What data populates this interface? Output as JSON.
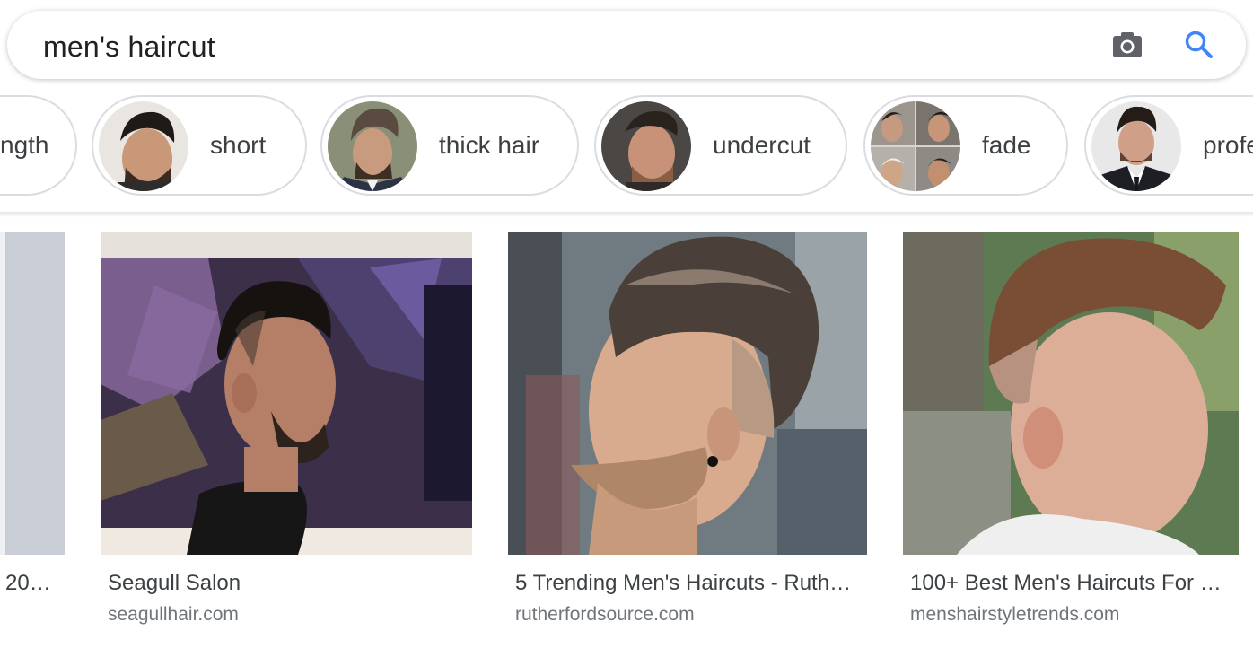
{
  "search": {
    "query": "men's haircut"
  },
  "icons": {
    "camera": "camera-icon",
    "search": "search-icon"
  },
  "chips": [
    {
      "label": "ngth",
      "partial": true
    },
    {
      "label": "short"
    },
    {
      "label": "thick hair"
    },
    {
      "label": "undercut"
    },
    {
      "label": "fade"
    },
    {
      "label": "profe",
      "partial": true
    }
  ],
  "results": [
    {
      "title": "20…",
      "site": ""
    },
    {
      "title": "Seagull Salon",
      "site": "seagullhair.com"
    },
    {
      "title": "5 Trending Men's Haircuts - Ruth…",
      "site": "rutherfordsource.com"
    },
    {
      "title": "100+ Best Men's Haircuts For …",
      "site": "menshairstyletrends.com"
    }
  ],
  "colors": {
    "search_blue": "#4285f4",
    "icon_gray": "#5f6368",
    "border": "#dadce0"
  }
}
